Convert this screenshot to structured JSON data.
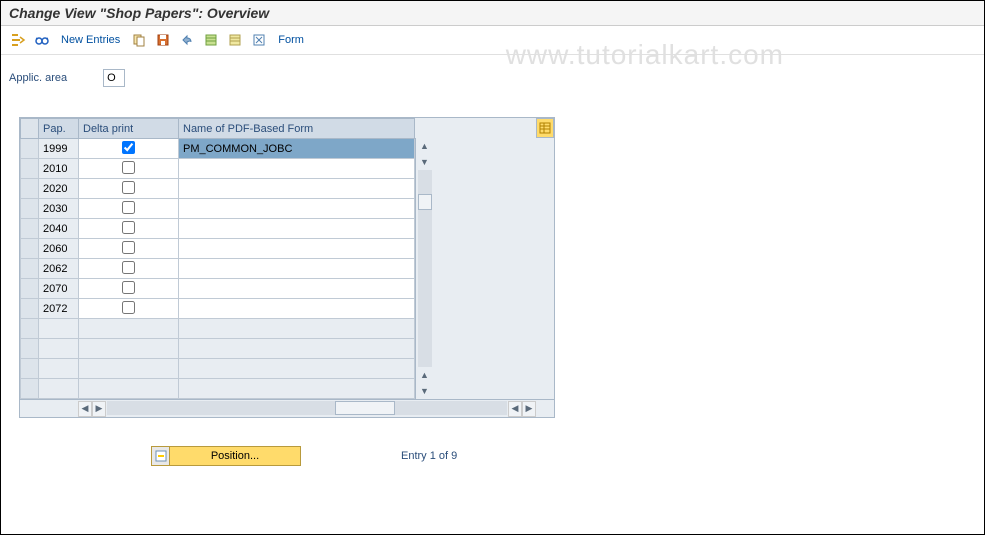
{
  "title": "Change View \"Shop Papers\": Overview",
  "toolbar": {
    "new_entries": "New Entries",
    "form": "Form"
  },
  "applic_area": {
    "label": "Applic. area",
    "value": "O"
  },
  "table": {
    "headers": {
      "pap": "Pap.",
      "delta": "Delta print",
      "form_name": "Name of PDF-Based Form"
    },
    "rows": [
      {
        "pap": "1999",
        "delta": true,
        "form": "PM_COMMON_JOBC",
        "selected": true
      },
      {
        "pap": "2010",
        "delta": false,
        "form": ""
      },
      {
        "pap": "2020",
        "delta": false,
        "form": ""
      },
      {
        "pap": "2030",
        "delta": false,
        "form": ""
      },
      {
        "pap": "2040",
        "delta": false,
        "form": ""
      },
      {
        "pap": "2060",
        "delta": false,
        "form": ""
      },
      {
        "pap": "2062",
        "delta": false,
        "form": ""
      },
      {
        "pap": "2070",
        "delta": false,
        "form": ""
      },
      {
        "pap": "2072",
        "delta": false,
        "form": ""
      }
    ]
  },
  "footer": {
    "position": "Position...",
    "entry": "Entry 1 of 9"
  },
  "watermark": "www.tutorialkart.com"
}
